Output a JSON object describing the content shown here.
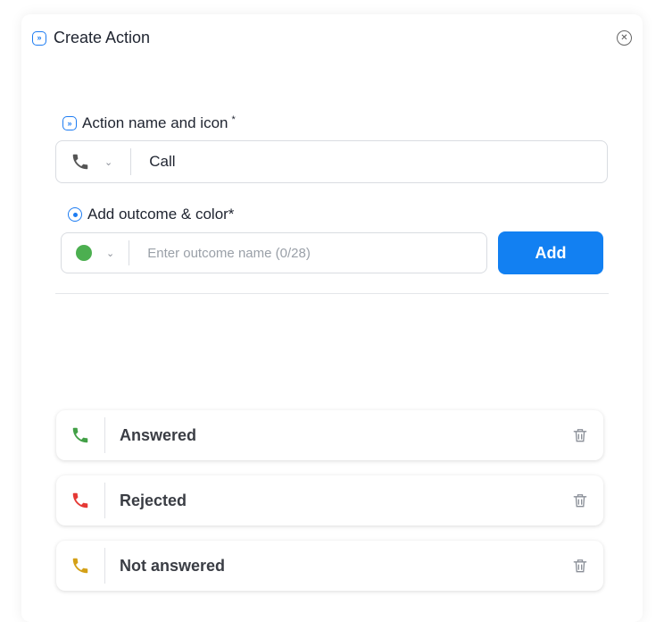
{
  "dialog": {
    "title": "Create Action",
    "title_icon": "action-icon",
    "close_icon": "close-icon"
  },
  "action": {
    "label": "Action name and icon",
    "required_mark": "*",
    "label_icon": "action-icon",
    "selected_icon": "phone-icon",
    "icon_color": "#555555",
    "name_value": "Call"
  },
  "outcome": {
    "label": "Add outcome & color*",
    "label_icon": "outcome-icon",
    "selected_color": "#4caf50",
    "input_placeholder": "Enter outcome name (0/28)",
    "input_value": "",
    "add_button": "Add"
  },
  "outcomes": [
    {
      "name": "Answered",
      "icon": "phone-icon",
      "color": "#43a047",
      "delete_icon": "trash-icon"
    },
    {
      "name": "Rejected",
      "icon": "phone-icon",
      "color": "#e53935",
      "delete_icon": "trash-icon"
    },
    {
      "name": "Not answered",
      "icon": "phone-icon",
      "color": "#d4a017",
      "delete_icon": "trash-icon"
    }
  ],
  "colors": {
    "accent": "#1280f2",
    "border": "#d9dce1"
  }
}
